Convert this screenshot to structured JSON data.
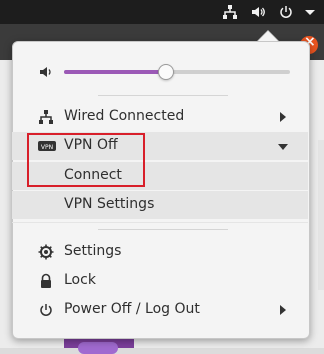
{
  "topbar": {
    "icons": [
      "network-wired-icon",
      "volume-icon",
      "power-icon",
      "dropdown-icon"
    ]
  },
  "volume": {
    "icon": "volume-icon",
    "level": 0.45
  },
  "menu": {
    "wired": {
      "label": "Wired Connected",
      "icon": "network-wired-icon"
    },
    "vpn": {
      "label": "VPN Off",
      "icon": "vpn-icon",
      "items": [
        {
          "label": "Connect"
        },
        {
          "label": "VPN Settings"
        }
      ]
    },
    "settings": {
      "label": "Settings",
      "icon": "gear-icon"
    },
    "lock": {
      "label": "Lock",
      "icon": "lock-icon"
    },
    "power": {
      "label": "Power Off / Log Out",
      "icon": "power-icon"
    }
  },
  "colors": {
    "accent": "#9b59b6",
    "highlight": "#d81f2a",
    "topbar": "#1d1d1d"
  }
}
